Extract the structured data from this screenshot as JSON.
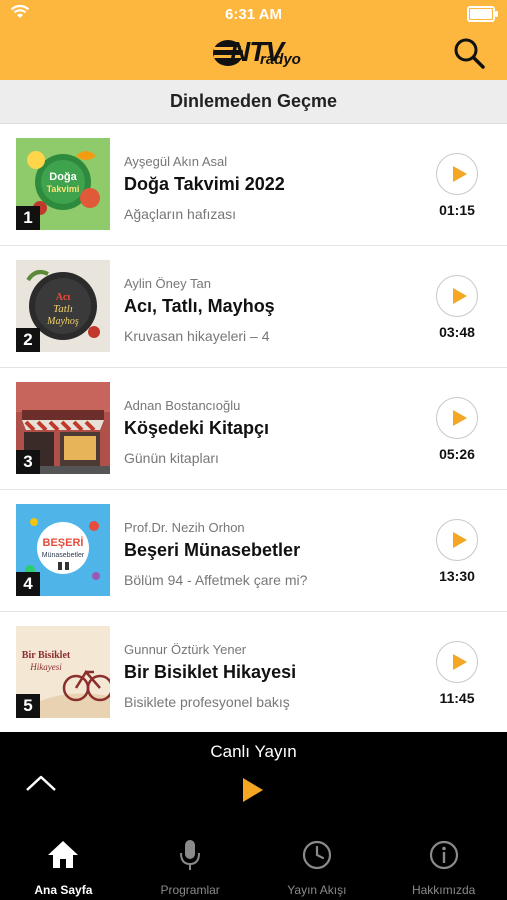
{
  "status_bar": {
    "time": "6:31 AM"
  },
  "header": {
    "logo_main": "NTV",
    "logo_sub": "radyo"
  },
  "section": {
    "title": "Dinlemeden Geçme"
  },
  "items": [
    {
      "rank": "1",
      "author": "Ayşegül Akın Asal",
      "title": "Doğa Takvimi 2022",
      "subtitle": "Ağaçların hafızası",
      "duration": "01:15"
    },
    {
      "rank": "2",
      "author": "Aylin Öney Tan",
      "title": "Acı, Tatlı, Mayhoş",
      "subtitle": "Kruvasan hikayeleri – 4",
      "duration": "03:48"
    },
    {
      "rank": "3",
      "author": "Adnan Bostancıoğlu",
      "title": "Köşedeki Kitapçı",
      "subtitle": "Günün kitapları",
      "duration": "05:26"
    },
    {
      "rank": "4",
      "author": "Prof.Dr. Nezih Orhon",
      "title": "Beşeri Münasebetler",
      "subtitle": "Bölüm 94 - Affetmek çare mi?",
      "duration": "13:30"
    },
    {
      "rank": "5",
      "author": "Gunnur Öztürk Yener",
      "title": "Bir Bisiklet Hikayesi",
      "subtitle": "Bisiklete profesyonel bakış",
      "duration": "11:45"
    }
  ],
  "live": {
    "label": "Canlı Yayın"
  },
  "tabs": [
    {
      "label": "Ana Sayfa",
      "icon": "home-icon"
    },
    {
      "label": "Programlar",
      "icon": "microphone-icon"
    },
    {
      "label": "Yayın Akışı",
      "icon": "clock-icon"
    },
    {
      "label": "Hakkımızda",
      "icon": "info-icon"
    }
  ],
  "colors": {
    "header": "#FDB73E",
    "accent": "#F5A623",
    "live_bar": "#000000"
  }
}
